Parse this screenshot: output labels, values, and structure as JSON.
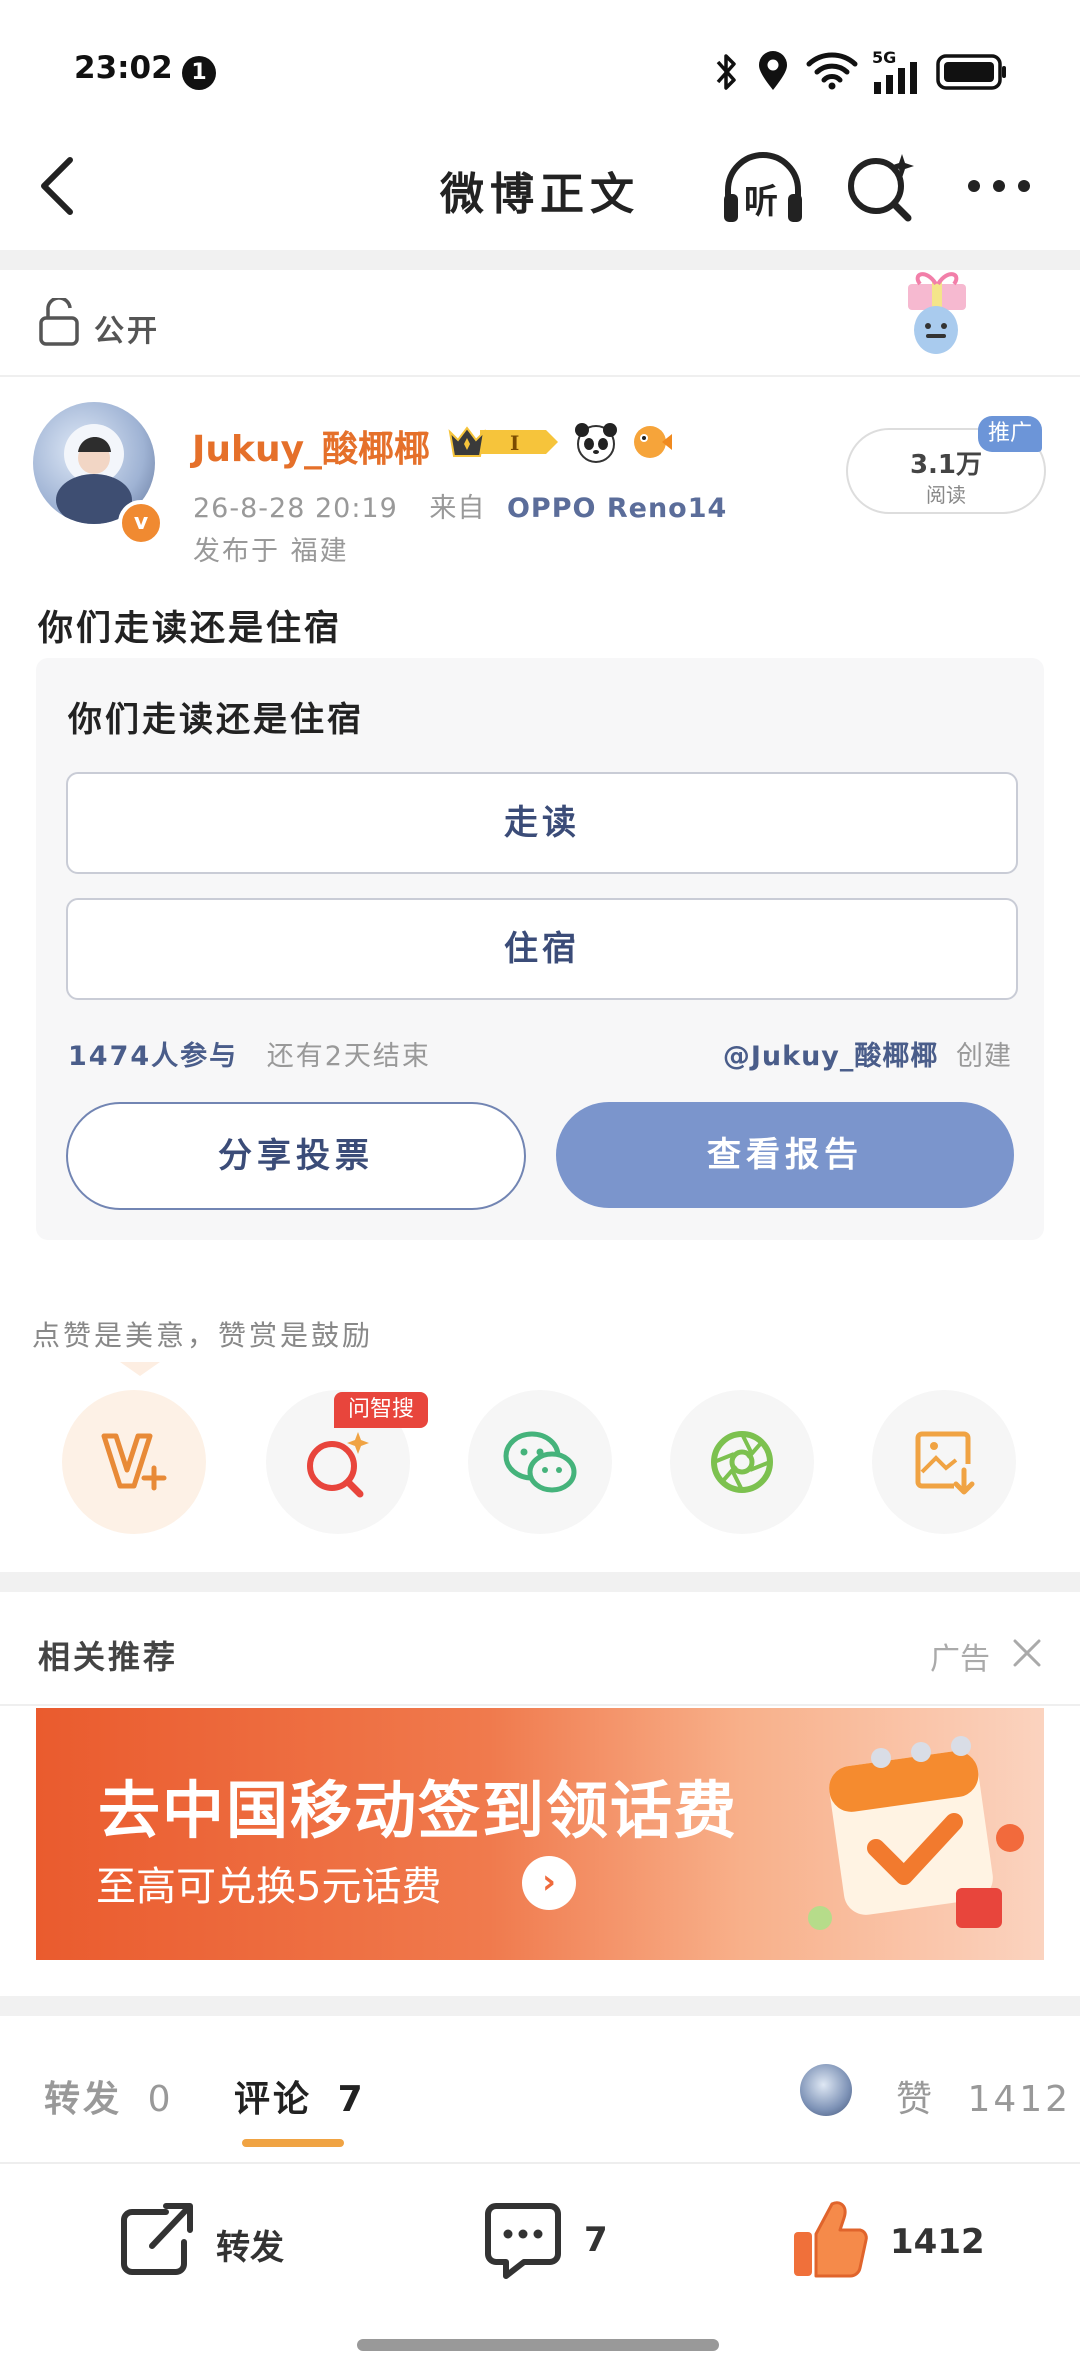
{
  "status_bar": {
    "time": "23:02",
    "notification_count": "1",
    "network": "5G"
  },
  "header": {
    "title": "微博正文",
    "listen_label": "听"
  },
  "visibility": {
    "label": "公开"
  },
  "author": {
    "name": "Jukuy_酸椰椰",
    "member_level": "I",
    "timestamp": "26-8-28 20:19",
    "from_label": "来自",
    "device": "OPPO Reno14",
    "location": "发布于 福建"
  },
  "stats": {
    "reads": "3.1万",
    "reads_label": "阅读",
    "promo_label": "推广"
  },
  "post": {
    "text": "你们走读还是住宿"
  },
  "poll": {
    "title": "你们走读还是住宿",
    "options": [
      {
        "label": "走读"
      },
      {
        "label": "住宿"
      }
    ],
    "participants": "1474人参与",
    "deadline": "还有2天结束",
    "creator": "@Jukuy_酸椰椰",
    "creator_suffix": "创建",
    "share_label": "分享投票",
    "report_label": "查看报告"
  },
  "reward": {
    "text": "点赞是美意，赞赏是鼓励",
    "ai_search_tag": "问智搜"
  },
  "recommend": {
    "title": "相关推荐",
    "ad_label": "广告"
  },
  "ad_banner": {
    "headline": "去中国移动签到领话费",
    "subline": "至高可兑换5元话费"
  },
  "tabs": {
    "repost_label": "转发",
    "repost_count": "0",
    "comment_label": "评论",
    "comment_count": "7",
    "like_label": "赞",
    "like_count": "1412"
  },
  "bottom_bar": {
    "repost_label": "转发",
    "comment_count": "7",
    "like_count": "1412"
  },
  "colors": {
    "accent_orange": "#e5702a",
    "poll_blue": "#7b95cc",
    "text_blue": "#4a5d8a",
    "tab_underline": "#f0a343"
  }
}
